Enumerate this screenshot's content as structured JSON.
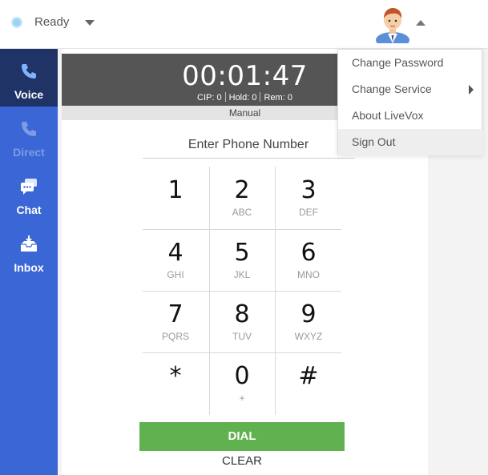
{
  "status": {
    "label": "Ready"
  },
  "sidebar": {
    "items": [
      {
        "label": "Voice",
        "icon": "phone-icon",
        "active": true
      },
      {
        "label": "Direct",
        "icon": "phone-icon",
        "disabled": true
      },
      {
        "label": "Chat",
        "icon": "chat-icon"
      },
      {
        "label": "Inbox",
        "icon": "inbox-icon"
      }
    ]
  },
  "call": {
    "timer": "00:01:47",
    "cip": "CIP: 0",
    "hold": "Hold: 0",
    "rem": "Rem: 0",
    "mode": "Manual"
  },
  "dialer": {
    "placeholder": "Enter Phone Number",
    "keys": [
      {
        "digit": "1",
        "letters": ""
      },
      {
        "digit": "2",
        "letters": "ABC"
      },
      {
        "digit": "3",
        "letters": "DEF"
      },
      {
        "digit": "4",
        "letters": "GHI"
      },
      {
        "digit": "5",
        "letters": "JKL"
      },
      {
        "digit": "6",
        "letters": "MNO"
      },
      {
        "digit": "7",
        "letters": "PQRS"
      },
      {
        "digit": "8",
        "letters": "TUV"
      },
      {
        "digit": "9",
        "letters": "WXYZ"
      },
      {
        "digit": "*",
        "letters": ""
      },
      {
        "digit": "0",
        "letters": "+"
      },
      {
        "digit": "#",
        "letters": ""
      }
    ],
    "dial_label": "DIAL",
    "clear_label": "CLEAR"
  },
  "user_menu": {
    "items": [
      {
        "label": "Change Password"
      },
      {
        "label": "Change Service",
        "submenu": true
      },
      {
        "label": "About LiveVox"
      },
      {
        "label": "Sign Out"
      }
    ]
  },
  "colors": {
    "sidebar": "#3b66d6",
    "sidebar_active": "#1f3366",
    "dial": "#62b150",
    "timer_bg": "#555555"
  }
}
